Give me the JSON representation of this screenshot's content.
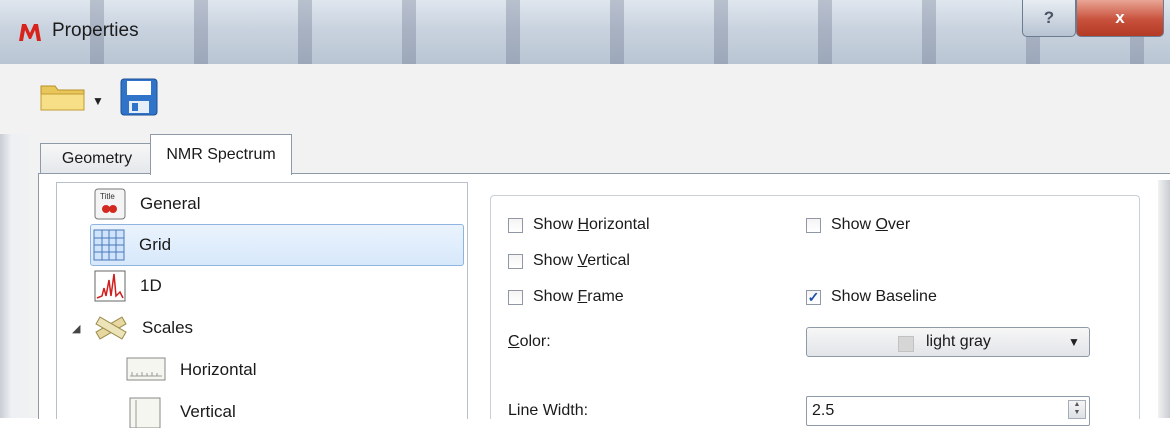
{
  "window": {
    "title": "Properties",
    "help_label": "?",
    "close_label": "x"
  },
  "toolbar": {
    "icons": [
      "folder-icon",
      "save-icon"
    ]
  },
  "tabs": [
    {
      "label": "Geometry"
    },
    {
      "label": "NMR Spectrum"
    }
  ],
  "tree": {
    "items": [
      {
        "label": "General",
        "icon": "title-icon"
      },
      {
        "label": "Grid",
        "icon": "grid-icon",
        "selected": true
      },
      {
        "label": "1D",
        "icon": "spectrum-icon"
      },
      {
        "label": "Scales",
        "icon": "scales-icon"
      },
      {
        "label": "Horizontal",
        "icon": "horizontal-scale-icon"
      },
      {
        "label": "Vertical",
        "icon": "vertical-scale-icon"
      }
    ]
  },
  "grid_options": {
    "show_horizontal": {
      "prefix": "Show ",
      "mnemonic": "H",
      "rest": "orizontal",
      "checked": false
    },
    "show_over": {
      "prefix": "Show ",
      "mnemonic": "O",
      "rest": "ver",
      "checked": false
    },
    "show_vertical": {
      "prefix": "Show ",
      "mnemonic": "V",
      "rest": "ertical",
      "checked": false
    },
    "show_frame": {
      "prefix": "Show ",
      "mnemonic": "F",
      "rest": "rame",
      "checked": false
    },
    "show_baseline": {
      "label": "Show Baseline",
      "checked": true
    },
    "color": {
      "mnemonic": "C",
      "rest": "olor:",
      "value": "light gray"
    },
    "line_width": {
      "label": "Line Width:",
      "value": "2.5"
    },
    "check_mark": "✓"
  }
}
